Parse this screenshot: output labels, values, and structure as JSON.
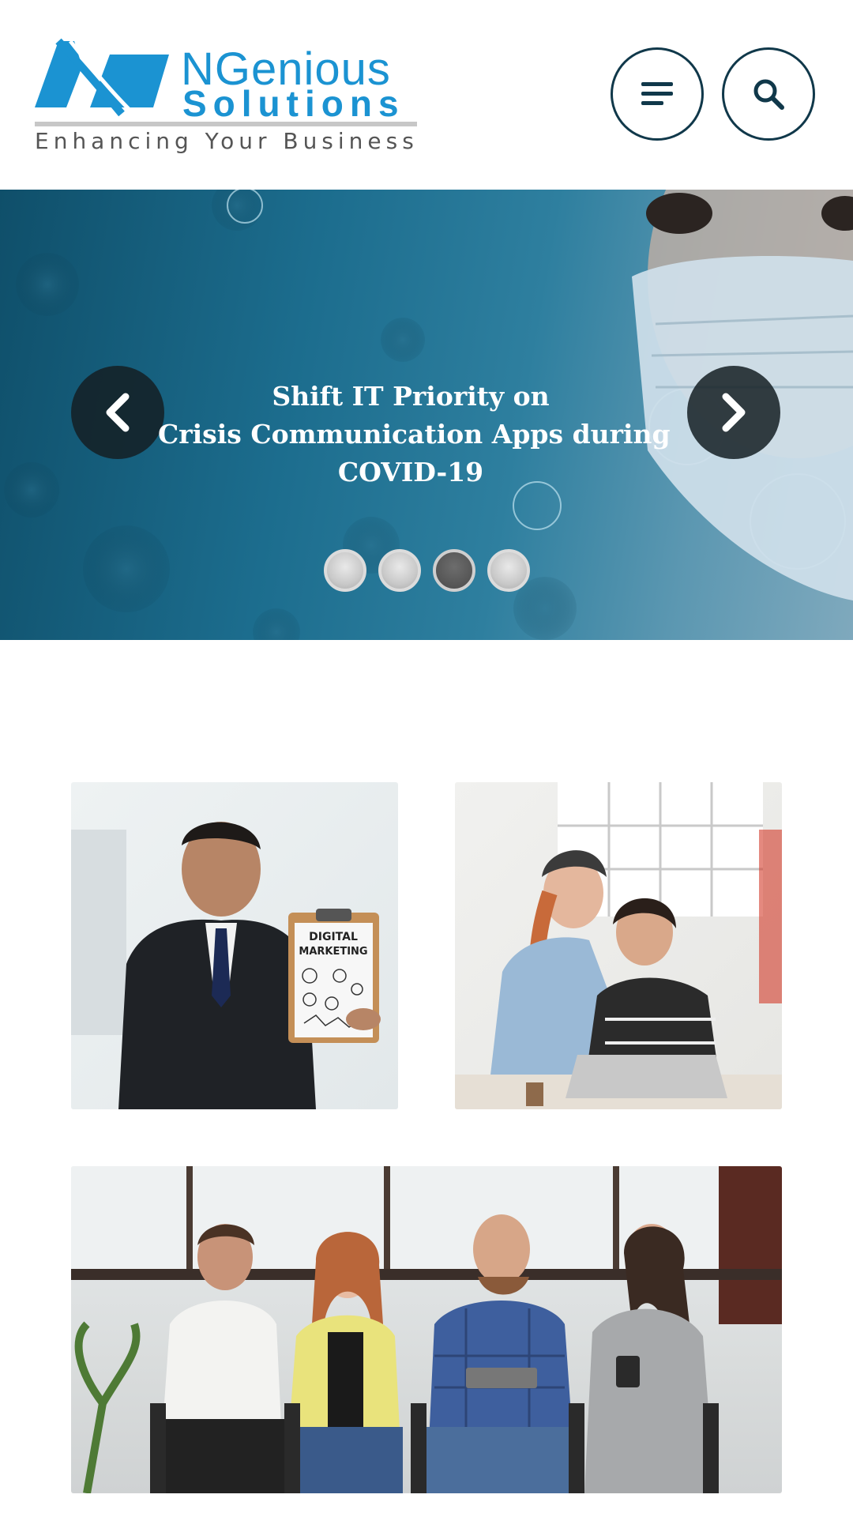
{
  "brand": {
    "name": "NGenious",
    "sub": "Solutions",
    "tagline": "Enhancing Your Business",
    "color": "#1b93d2"
  },
  "header": {
    "menu_icon": "hamburger-menu-icon",
    "search_icon": "search-icon",
    "accent": "#10384a"
  },
  "hero": {
    "title_lines": [
      "Shift IT Priority on",
      "Crisis Communication Apps during",
      "COVID-19"
    ],
    "prev_icon": "chevron-left-icon",
    "next_icon": "chevron-right-icon",
    "slide_count": 4,
    "active_slide": 3
  },
  "cards": [
    {
      "name": "digital-marketing-image",
      "clipboard_text": [
        "DIGITAL",
        "MARKETING"
      ]
    },
    {
      "name": "office-collaboration-image"
    },
    {
      "name": "team-meeting-image"
    }
  ]
}
